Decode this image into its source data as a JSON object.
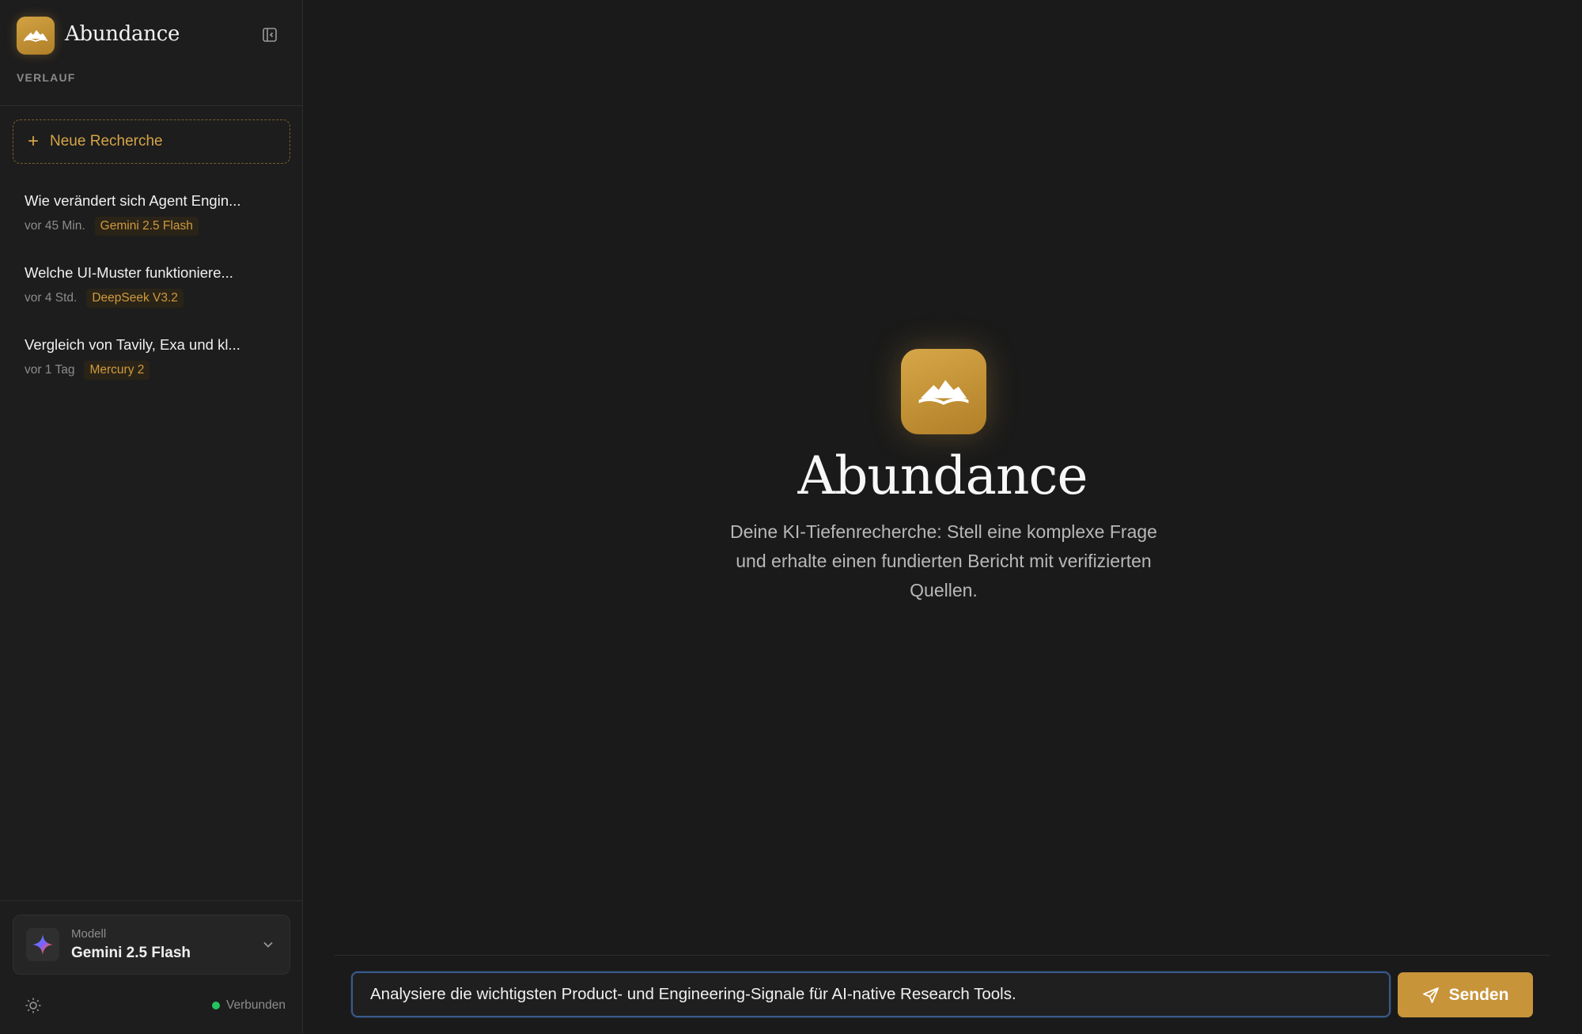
{
  "app": {
    "name": "Abundance"
  },
  "sidebar": {
    "section_label": "VERLAUF",
    "new_button_label": "Neue Recherche",
    "history": [
      {
        "title": "Wie verändert sich Agent Engin...",
        "time": "vor 45 Min.",
        "model": "Gemini 2.5 Flash"
      },
      {
        "title": "Welche UI-Muster funktioniere...",
        "time": "vor 4 Std.",
        "model": "DeepSeek V3.2"
      },
      {
        "title": "Vergleich von Tavily, Exa und kl...",
        "time": "vor 1 Tag",
        "model": "Mercury 2"
      }
    ],
    "model_label": "Modell",
    "model_name": "Gemini 2.5 Flash",
    "status_text": "Verbunden",
    "status_color": "#22c55e"
  },
  "main": {
    "title": "Abundance",
    "subtitle": "Deine KI-Tiefenrecherche: Stell eine komplexe Frage und erhalte einen fundierten Bericht mit verifizierten Quellen.",
    "input_value": "Analysiere die wichtigsten Product- und Engineering-Signale für AI-native Research Tools.",
    "send_label": "Senden"
  },
  "colors": {
    "accent": "#c8943a",
    "background": "#1a1a1a",
    "sidebar_bg": "#1d1d1d"
  },
  "icons": {
    "logo": "mountain-book-icon",
    "collapse": "sidebar-collapse-icon",
    "model": "gemini-sparkle-icon",
    "chevron": "chevron-down-icon",
    "theme": "sun-icon",
    "send": "paper-plane-icon"
  }
}
